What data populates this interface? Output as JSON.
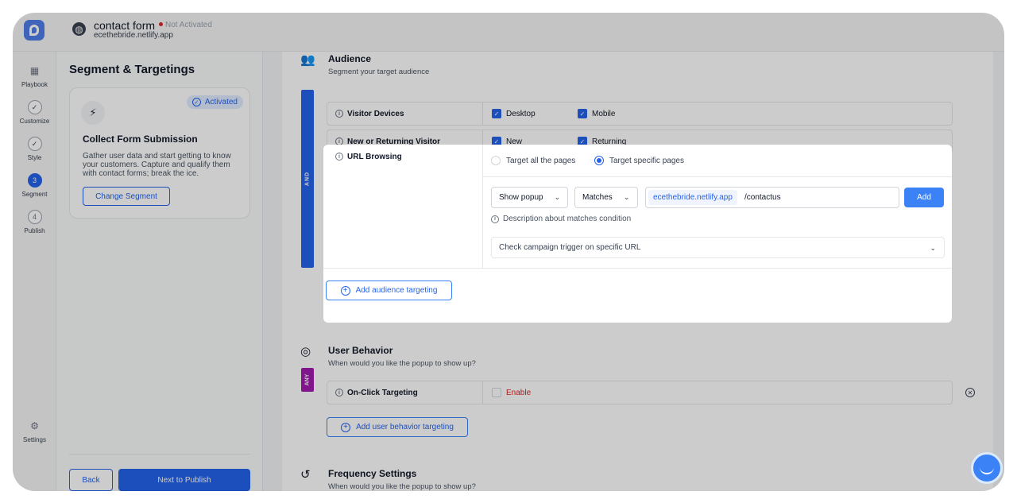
{
  "header": {
    "title": "contact form",
    "status": "Not Activated",
    "site": "ecethebride.netlify.app"
  },
  "nav": [
    {
      "label": "Playbook",
      "marker": ""
    },
    {
      "label": "Customize",
      "marker": "✓"
    },
    {
      "label": "Style",
      "marker": "✓"
    },
    {
      "label": "Segment",
      "marker": "3"
    },
    {
      "label": "Publish",
      "marker": "4"
    },
    {
      "label": "Settings",
      "marker": ""
    }
  ],
  "left_panel": {
    "title": "Segment & Targetings",
    "card": {
      "badge": "Activated",
      "title": "Collect Form Submission",
      "description": "Gather user data and start getting to know your customers. Capture and qualify them with contact forms; break the ice.",
      "change_label": "Change Segment"
    },
    "back_label": "Back",
    "next_label": "Next to Publish"
  },
  "audience": {
    "title": "Audience",
    "subtitle": "Segment your target audience",
    "operator": "AND",
    "rows": [
      {
        "label": "Visitor Devices",
        "options": [
          "Desktop",
          "Mobile"
        ]
      },
      {
        "label": "New or Returning Visitor",
        "options": [
          "New",
          "Returning"
        ]
      }
    ],
    "url_browsing": {
      "label": "URL Browsing",
      "radio_all": "Target all the pages",
      "radio_specific": "Target specific pages",
      "action_select": "Show popup",
      "condition_select": "Matches",
      "url_prefix": "ecethebride.netlify.app",
      "url_path": "/contactus",
      "add_label": "Add",
      "description": "Description about matches condition",
      "trigger_placeholder": "Check campaign trigger on specific URL"
    },
    "add_label": "Add audience targeting"
  },
  "behavior": {
    "title": "User Behavior",
    "subtitle": "When would you like the popup to show up?",
    "operator": "ANY",
    "row_label": "On-Click Targeting",
    "enable_label": "Enable",
    "add_label": "Add user behavior targeting"
  },
  "frequency": {
    "title": "Frequency Settings",
    "subtitle": "When would you like the popup to show up?"
  },
  "colors": {
    "primary": "#2563eb",
    "any": "#a21caf",
    "danger": "#dc2626"
  }
}
